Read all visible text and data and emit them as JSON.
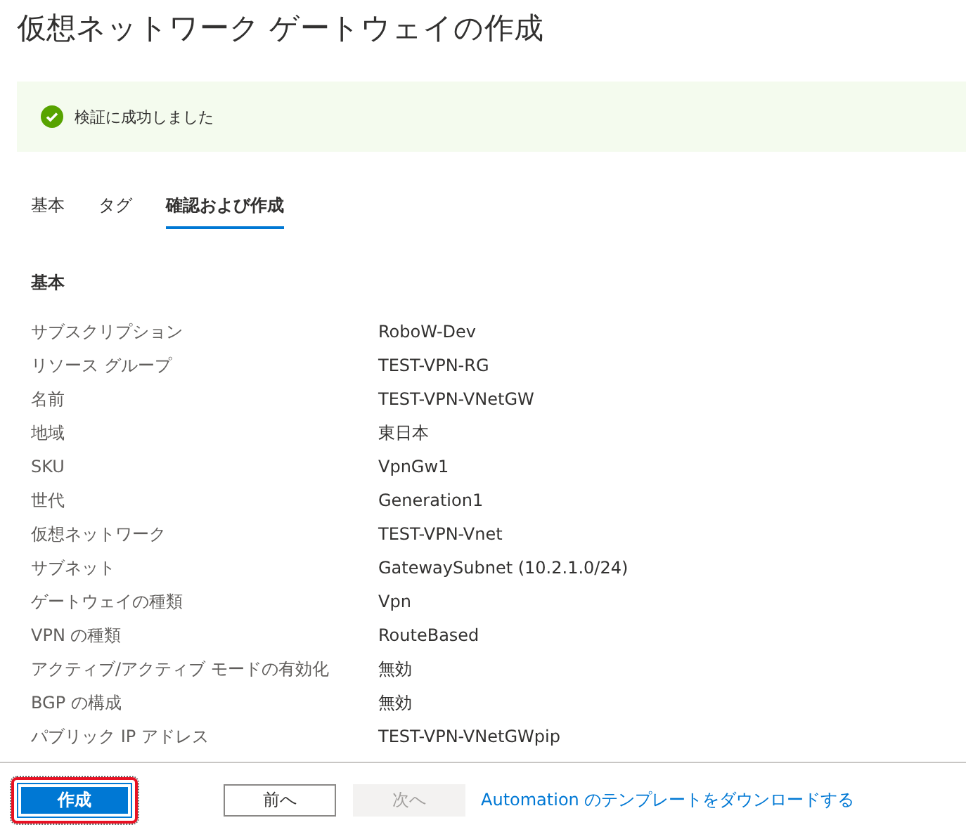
{
  "page": {
    "title": "仮想ネットワーク ゲートウェイの作成"
  },
  "banner": {
    "success": true,
    "message": "検証に成功しました"
  },
  "tabs": [
    {
      "label": "基本",
      "selected": false
    },
    {
      "label": "タグ",
      "selected": false
    },
    {
      "label": "確認および作成",
      "selected": true
    }
  ],
  "section": {
    "heading": "基本",
    "rows": [
      {
        "label": "サブスクリプション",
        "value": "RoboW-Dev"
      },
      {
        "label": "リソース グループ",
        "value": "TEST-VPN-RG"
      },
      {
        "label": "名前",
        "value": "TEST-VPN-VNetGW"
      },
      {
        "label": "地域",
        "value": "東日本"
      },
      {
        "label": "SKU",
        "value": "VpnGw1"
      },
      {
        "label": "世代",
        "value": "Generation1"
      },
      {
        "label": "仮想ネットワーク",
        "value": "TEST-VPN-Vnet"
      },
      {
        "label": "サブネット",
        "value": "GatewaySubnet (10.2.1.0/24)"
      },
      {
        "label": "ゲートウェイの種類",
        "value": "Vpn"
      },
      {
        "label": "VPN の種類",
        "value": "RouteBased"
      },
      {
        "label": "アクティブ/アクティブ モードの有効化",
        "value": "無効"
      },
      {
        "label": "BGP の構成",
        "value": "無効"
      },
      {
        "label": "パブリック IP アドレス",
        "value": "TEST-VPN-VNetGWpip"
      }
    ]
  },
  "footer": {
    "buttons": [
      {
        "label": "作成",
        "kind": "primary",
        "disabled": false,
        "focused": true
      },
      {
        "label": "前へ",
        "kind": "secondary",
        "disabled": false,
        "focused": false
      },
      {
        "label": "次へ",
        "kind": "secondary",
        "disabled": true,
        "focused": false
      }
    ],
    "link": "Automation のテンプレートをダウンロードする"
  }
}
